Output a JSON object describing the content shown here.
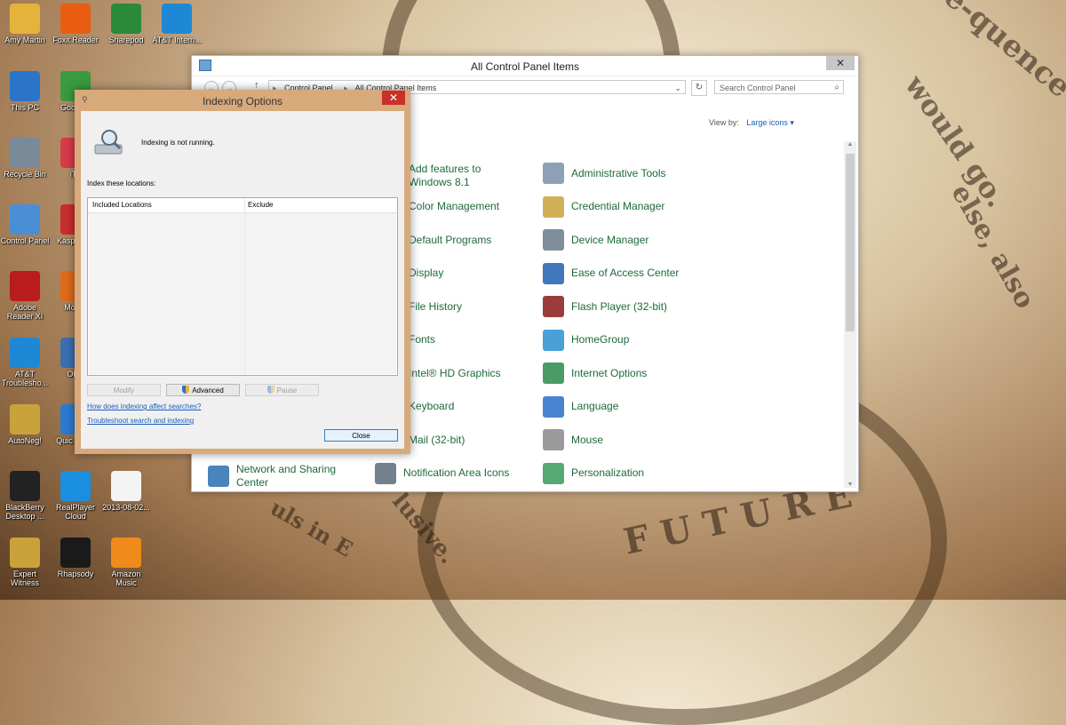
{
  "desktop": {
    "icons": [
      {
        "label": "Amy Martin",
        "icon": "folder-icon",
        "color": "#e3b33b"
      },
      {
        "label": "Foxit Reader",
        "icon": "pdf-icon",
        "color": "#e85d12"
      },
      {
        "label": "Sharepod",
        "icon": "sharepod-icon",
        "color": "#2a8a3a"
      },
      {
        "label": "AT&T Intern...",
        "icon": "att-icon",
        "color": "#1e88d6"
      },
      {
        "label": "This PC",
        "icon": "computer-icon",
        "color": "#2a75c9"
      },
      {
        "label": "Goo Chr",
        "icon": "chrome-icon",
        "color": "#3a9a3f"
      },
      {
        "label": "Recycle Bin",
        "icon": "recycle-bin-icon",
        "color": "#7a8a99"
      },
      {
        "label": "iTu",
        "icon": "itunes-icon",
        "color": "#d83a4a"
      },
      {
        "label": "Control Panel",
        "icon": "control-panel-icon",
        "color": "#4a8fd6"
      },
      {
        "label": "Kasp PUR",
        "icon": "kaspersky-icon",
        "color": "#c92d2d"
      },
      {
        "label": "Adobe Reader XI",
        "icon": "adobe-reader-icon",
        "color": "#b81c1c"
      },
      {
        "label": "Mo Fir",
        "icon": "firefox-icon",
        "color": "#e06a1a"
      },
      {
        "label": "AT&T Troublesho...",
        "icon": "att-icon",
        "color": "#1e88d6"
      },
      {
        "label": "Obje",
        "icon": "shortcut-icon",
        "color": "#3a6fb0"
      },
      {
        "label": "AutoNeg!",
        "icon": "scales-icon",
        "color": "#c9a23a"
      },
      {
        "label": "Quic Playe",
        "icon": "quicktime-icon",
        "color": "#2a7bd0"
      },
      {
        "label": "BlackBerry Desktop ...",
        "icon": "blackberry-icon",
        "color": "#222222"
      },
      {
        "label": "RealPlayer Cloud",
        "icon": "realplayer-icon",
        "color": "#1a8fe0"
      },
      {
        "label": "2013-08-02...",
        "icon": "file-icon",
        "color": "#f4f4f4"
      },
      {
        "label": "Expert Witness",
        "icon": "scales-icon",
        "color": "#c9a23a"
      },
      {
        "label": "Rhapsody",
        "icon": "rhapsody-icon",
        "color": "#1a1a1a"
      },
      {
        "label": "Amazon Music",
        "icon": "amazon-music-icon",
        "color": "#f08a1a"
      }
    ]
  },
  "control_panel": {
    "title": "All Control Panel Items",
    "close_glyph": "✕",
    "breadcrumb": [
      "Control Panel",
      "All Control Panel Items"
    ],
    "search_placeholder": "Search Control Panel",
    "view_by_label": "View by:",
    "view_by_value": "Large icons",
    "items": [
      {
        "label": "Add features to Windows 8.1",
        "icon": "add-features-icon",
        "color": "#3a7bd5"
      },
      {
        "label": "Administrative Tools",
        "icon": "administrative-tools-icon",
        "color": "#7a8fa8"
      },
      {
        "label": "Color Management",
        "icon": "color-management-icon",
        "color": "#8a5ac9"
      },
      {
        "label": "Credential Manager",
        "icon": "credential-manager-icon",
        "color": "#c9a23a"
      },
      {
        "label": "Default Programs",
        "icon": "default-programs-icon",
        "color": "#3aa05a"
      },
      {
        "label": "Device Manager",
        "icon": "device-manager-icon",
        "color": "#6a7a8a"
      },
      {
        "label": "Display",
        "icon": "display-icon",
        "color": "#3a7bd5"
      },
      {
        "label": "Ease of Access Center",
        "icon": "ease-of-access-icon",
        "color": "#1e5fb0"
      },
      {
        "label": "File History",
        "icon": "file-history-icon",
        "color": "#e3b33b"
      },
      {
        "label": "Flash Player (32-bit)",
        "icon": "flash-player-icon",
        "color": "#8a1a1a"
      },
      {
        "label": "Fonts",
        "icon": "fonts-icon",
        "color": "#e3b33b"
      },
      {
        "label": "HomeGroup",
        "icon": "homegroup-icon",
        "color": "#2a8fd0"
      },
      {
        "label": "Intel® HD Graphics",
        "icon": "intel-graphics-icon",
        "color": "#1a5fb0"
      },
      {
        "label": "Internet Options",
        "icon": "internet-options-icon",
        "color": "#2a8a4a"
      },
      {
        "label": "Keyboard",
        "icon": "keyboard-icon",
        "color": "#6a6a6a"
      },
      {
        "label": "Language",
        "icon": "language-icon",
        "color": "#2a6fc9"
      },
      {
        "label": "Mail (32-bit)",
        "icon": "mail-icon",
        "color": "#3a7bd5"
      },
      {
        "label": "Mouse",
        "icon": "mouse-icon",
        "color": "#8a8a8a"
      },
      {
        "label": "Network and Sharing Center",
        "icon": "network-sharing-icon",
        "color": "#2a6fb0"
      },
      {
        "label": "Notification Area Icons",
        "icon": "notification-area-icon",
        "color": "#5a6a7a"
      },
      {
        "label": "Personalization",
        "icon": "personalization-icon",
        "color": "#3a9a5a"
      }
    ]
  },
  "indexing_dialog": {
    "title": "Indexing Options",
    "close_glyph": "✕",
    "status": "Indexing is not running.",
    "locations_label": "Index these locations:",
    "columns": [
      "Included Locations",
      "Exclude"
    ],
    "buttons": {
      "modify": "Modify",
      "advanced": "Advanced",
      "pause": "Pause",
      "close": "Close"
    },
    "links": [
      "How does indexing affect searches?",
      "Troubleshoot search and indexing"
    ]
  }
}
